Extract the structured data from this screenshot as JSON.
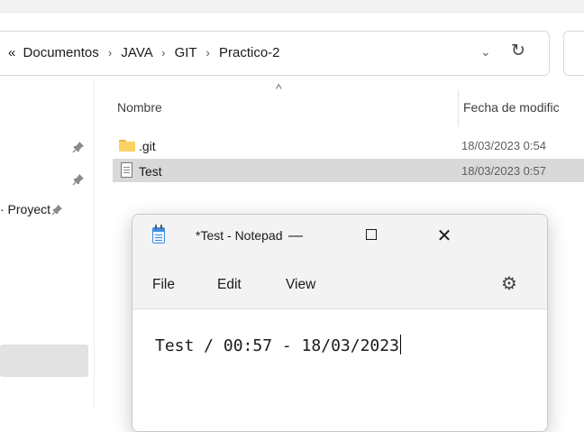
{
  "explorer": {
    "address": {
      "overflow_glyph": "«",
      "crumbs": [
        "Documentos",
        "JAVA",
        "GIT",
        "Practico-2"
      ],
      "separator": "›",
      "dropdown_glyph": "⌄",
      "refresh_glyph": "↻"
    },
    "nav": {
      "pin_glyph": "📌",
      "item_label": "· Proyect"
    },
    "columns": {
      "name": "Nombre",
      "date": "Fecha de modific",
      "sort_glyph": "^"
    },
    "files": [
      {
        "name": ".git",
        "date": "18/03/2023 0:54",
        "icon": "folder-icon",
        "selected": false
      },
      {
        "name": "Test",
        "date": "18/03/2023 0:57",
        "icon": "text-file-icon",
        "selected": true
      }
    ]
  },
  "notepad": {
    "title": "*Test - Notepad",
    "controls": {
      "minimize": "—",
      "close": "✕"
    },
    "menu": [
      "File",
      "Edit",
      "View"
    ],
    "settings_glyph": "⚙",
    "content": "Test / 00:57 - 18/03/2023"
  },
  "colors": {
    "selection": "#d9d9d9",
    "folder": "#f8d364",
    "notepad_icon": "#3d8ee0"
  }
}
